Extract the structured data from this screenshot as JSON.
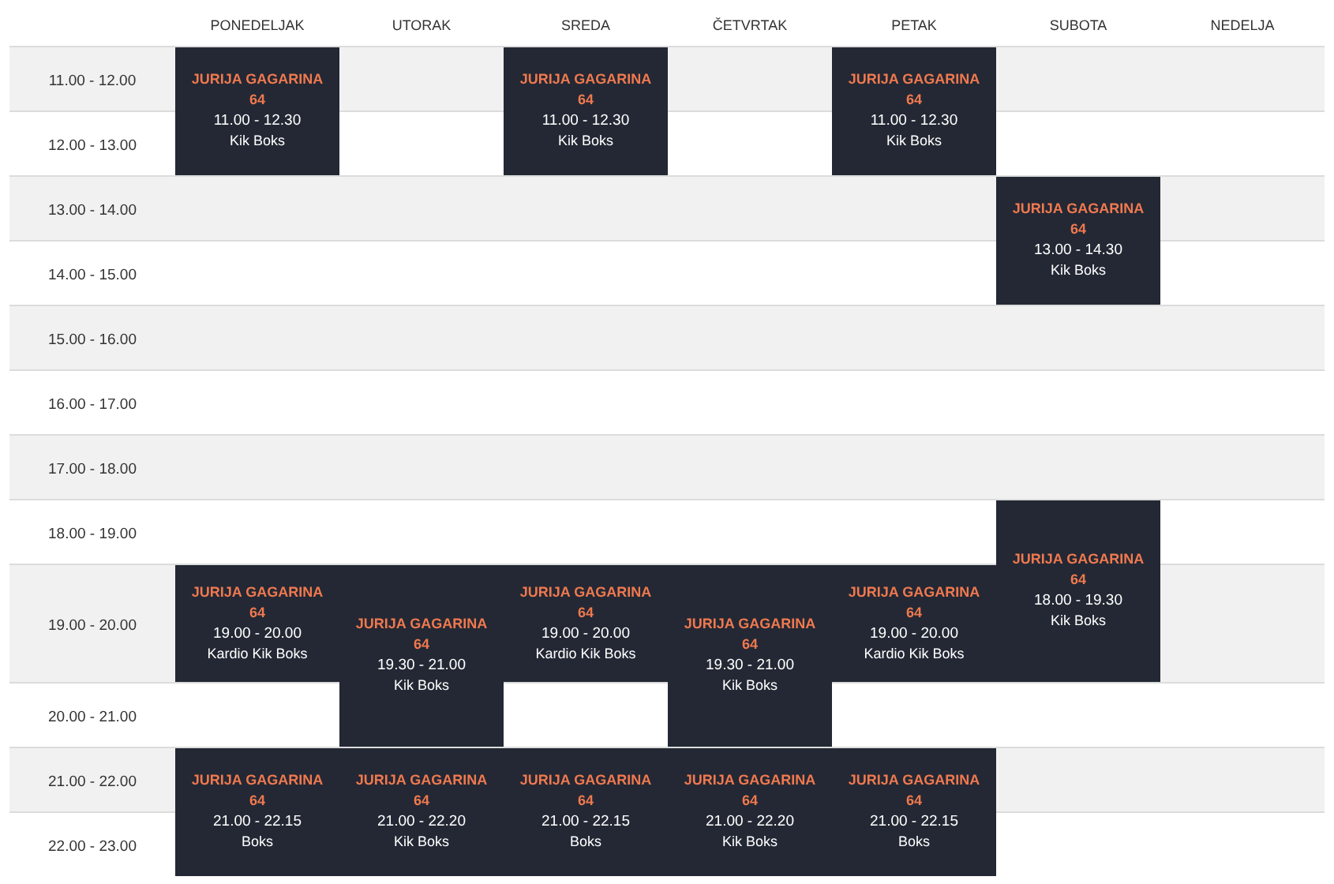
{
  "days": [
    "PONEDELJAK",
    "UTORAK",
    "SREDA",
    "ČETVRTAK",
    "PETAK",
    "SUBOTA",
    "NEDELJA"
  ],
  "rows": [
    {
      "time": "11.00 - 12.00",
      "cells": [
        {
          "kind": "event",
          "location": "JURIJA GAGARINA 64",
          "time": "11.00 - 12.30",
          "class": "Kik Boks"
        },
        {
          "kind": "empty"
        },
        {
          "kind": "event",
          "location": "JURIJA GAGARINA 64",
          "time": "11.00 - 12.30",
          "class": "Kik Boks"
        },
        {
          "kind": "empty"
        },
        {
          "kind": "event",
          "location": "JURIJA GAGARINA 64",
          "time": "11.00 - 12.30",
          "class": "Kik Boks"
        },
        {
          "kind": "empty"
        },
        {
          "kind": "empty"
        }
      ]
    },
    {
      "time": "12.00 - 13.00",
      "cells": [
        {
          "kind": "covered"
        },
        {
          "kind": "empty"
        },
        {
          "kind": "covered"
        },
        {
          "kind": "empty"
        },
        {
          "kind": "covered"
        },
        {
          "kind": "empty"
        },
        {
          "kind": "empty"
        }
      ]
    },
    {
      "time": "13.00 - 14.00",
      "cells": [
        {
          "kind": "empty"
        },
        {
          "kind": "empty"
        },
        {
          "kind": "empty"
        },
        {
          "kind": "empty"
        },
        {
          "kind": "empty"
        },
        {
          "kind": "event",
          "location": "JURIJA GAGARINA 64",
          "time": "13.00 - 14.30",
          "class": "Kik Boks"
        },
        {
          "kind": "empty"
        }
      ]
    },
    {
      "time": "14.00 - 15.00",
      "cells": [
        {
          "kind": "empty"
        },
        {
          "kind": "empty"
        },
        {
          "kind": "empty"
        },
        {
          "kind": "empty"
        },
        {
          "kind": "empty"
        },
        {
          "kind": "covered"
        },
        {
          "kind": "empty"
        }
      ]
    },
    {
      "time": "15.00 - 16.00",
      "cells": [
        {
          "kind": "empty"
        },
        {
          "kind": "empty"
        },
        {
          "kind": "empty"
        },
        {
          "kind": "empty"
        },
        {
          "kind": "empty"
        },
        {
          "kind": "empty"
        },
        {
          "kind": "empty"
        }
      ]
    },
    {
      "time": "16.00 - 17.00",
      "cells": [
        {
          "kind": "empty"
        },
        {
          "kind": "empty"
        },
        {
          "kind": "empty"
        },
        {
          "kind": "empty"
        },
        {
          "kind": "empty"
        },
        {
          "kind": "empty"
        },
        {
          "kind": "empty"
        }
      ]
    },
    {
      "time": "17.00 - 18.00",
      "cells": [
        {
          "kind": "empty"
        },
        {
          "kind": "empty"
        },
        {
          "kind": "empty"
        },
        {
          "kind": "empty"
        },
        {
          "kind": "empty"
        },
        {
          "kind": "empty"
        },
        {
          "kind": "empty"
        }
      ]
    },
    {
      "time": "18.00 - 19.00",
      "cells": [
        {
          "kind": "empty"
        },
        {
          "kind": "empty"
        },
        {
          "kind": "empty"
        },
        {
          "kind": "empty"
        },
        {
          "kind": "empty"
        },
        {
          "kind": "event",
          "location": "JURIJA GAGARINA 64",
          "time": "18.00 - 19.30",
          "class": "Kik Boks"
        },
        {
          "kind": "empty"
        }
      ]
    },
    {
      "time": "19.00 - 20.00",
      "cells": [
        {
          "kind": "event",
          "location": "JURIJA GAGARINA 64",
          "time": "19.00 - 20.00",
          "class": "Kardio Kik Boks"
        },
        {
          "kind": "event",
          "location": "JURIJA GAGARINA 64",
          "time": "19.30 - 21.00",
          "class": "Kik Boks"
        },
        {
          "kind": "event",
          "location": "JURIJA GAGARINA 64",
          "time": "19.00 - 20.00",
          "class": "Kardio Kik Boks"
        },
        {
          "kind": "event",
          "location": "JURIJA GAGARINA 64",
          "time": "19.30 - 21.00",
          "class": "Kik Boks"
        },
        {
          "kind": "event",
          "location": "JURIJA GAGARINA 64",
          "time": "19.00 - 20.00",
          "class": "Kardio Kik Boks"
        },
        {
          "kind": "covered"
        },
        {
          "kind": "empty"
        }
      ]
    },
    {
      "time": "20.00 - 21.00",
      "cells": [
        {
          "kind": "empty"
        },
        {
          "kind": "covered"
        },
        {
          "kind": "empty"
        },
        {
          "kind": "covered"
        },
        {
          "kind": "empty"
        },
        {
          "kind": "empty"
        },
        {
          "kind": "empty"
        }
      ]
    },
    {
      "time": "21.00 - 22.00",
      "cells": [
        {
          "kind": "event",
          "location": "JURIJA GAGARINA 64",
          "time": "21.00 - 22.15",
          "class": "Boks"
        },
        {
          "kind": "event",
          "location": "JURIJA GAGARINA 64",
          "time": "21.00 - 22.20",
          "class": "Kik Boks"
        },
        {
          "kind": "event",
          "location": "JURIJA GAGARINA 64",
          "time": "21.00 - 22.15",
          "class": "Boks"
        },
        {
          "kind": "event",
          "location": "JURIJA GAGARINA 64",
          "time": "21.00 - 22.20",
          "class": "Kik Boks"
        },
        {
          "kind": "event",
          "location": "JURIJA GAGARINA 64",
          "time": "21.00 - 22.15",
          "class": "Boks"
        },
        {
          "kind": "empty"
        },
        {
          "kind": "empty"
        }
      ]
    },
    {
      "time": "22.00 - 23.00",
      "cells": [
        {
          "kind": "covered"
        },
        {
          "kind": "covered"
        },
        {
          "kind": "covered"
        },
        {
          "kind": "covered"
        },
        {
          "kind": "covered"
        },
        {
          "kind": "empty"
        },
        {
          "kind": "empty"
        }
      ]
    }
  ]
}
